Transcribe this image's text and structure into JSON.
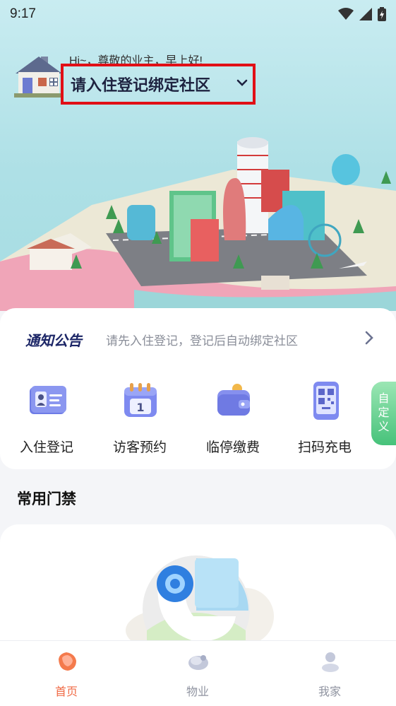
{
  "status_bar": {
    "time": "9:17"
  },
  "header": {
    "greeting": "Hi~，尊敬的业主，早上好!",
    "community_label": "请入住登记绑定社区"
  },
  "notice": {
    "title": "通知公告",
    "text": "请先入住登记，登记后自动绑定社区"
  },
  "shortcuts": [
    {
      "label": "入住登记",
      "icon": "id-card-icon"
    },
    {
      "label": "访客预约",
      "icon": "calendar-icon"
    },
    {
      "label": "临停缴费",
      "icon": "wallet-icon"
    },
    {
      "label": "扫码充电",
      "icon": "qr-phone-icon"
    }
  ],
  "custom_tab": {
    "line1": "自",
    "line2": "定",
    "line3": "义"
  },
  "section": {
    "title": "常用门禁"
  },
  "bottom_nav": [
    {
      "label": "首页",
      "active": true
    },
    {
      "label": "物业",
      "active": false
    },
    {
      "label": "我家",
      "active": false
    }
  ],
  "colors": {
    "accent_orange": "#f06a45",
    "highlight_red": "#e10f16",
    "notice_title": "#1b2566",
    "custom_green": "#46c27a"
  }
}
